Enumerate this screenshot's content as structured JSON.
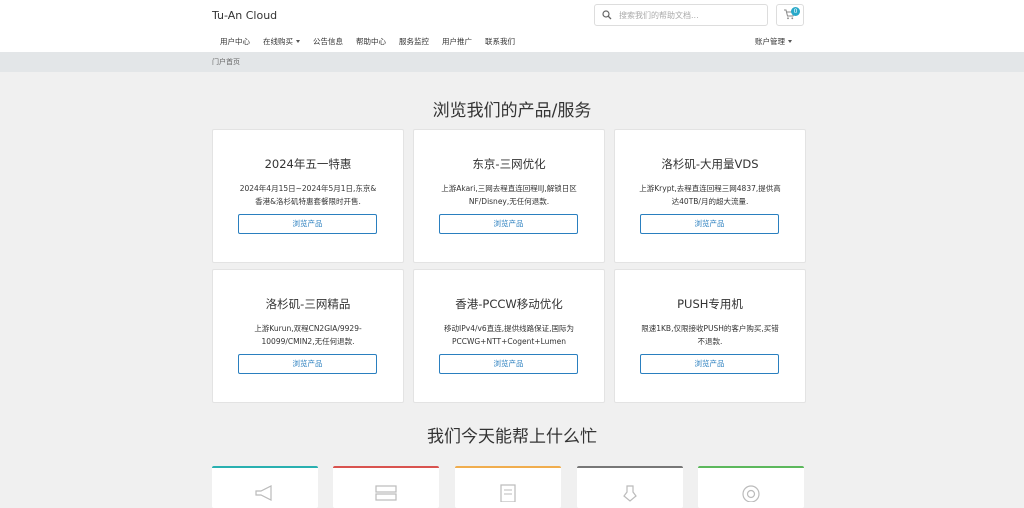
{
  "header": {
    "brand": "Tu-An Cloud",
    "search_placeholder": "搜索我们的帮助文档...",
    "cart_count": "0"
  },
  "nav": {
    "items": [
      {
        "label": "用户中心",
        "dropdown": false
      },
      {
        "label": "在线购买",
        "dropdown": true
      },
      {
        "label": "公告信息",
        "dropdown": false
      },
      {
        "label": "帮助中心",
        "dropdown": false
      },
      {
        "label": "服务监控",
        "dropdown": false
      },
      {
        "label": "用户推广",
        "dropdown": false
      },
      {
        "label": "联系我们",
        "dropdown": false
      }
    ],
    "account": "账户管理"
  },
  "breadcrumb": "门户首页",
  "products": {
    "title": "浏览我们的产品/服务",
    "button_label": "浏览产品",
    "cards": [
      {
        "title": "2024年五一特惠",
        "desc": "2024年4月15日~2024年5月1日,东京&香港&洛杉矶特惠套餐限时开售."
      },
      {
        "title": "东京-三网优化",
        "desc": "上游Akari,三网去程直连回程IIJ,解锁日区NF/Disney,无任何退款."
      },
      {
        "title": "洛杉矶-大用量VDS",
        "desc": "上游Krypt,去程直连回程三网4837,提供高达40TB/月的超大流量."
      },
      {
        "title": "洛杉矶-三网精品",
        "desc": "上游Kurun,双程CN2GIA/9929-10099/CMIN2,无任何退款."
      },
      {
        "title": "香港-PCCW移动优化",
        "desc": "移动IPv4/v6直连,提供线路保证,国际为PCCWG+NTT+Cogent+Lumen"
      },
      {
        "title": "PUSH专用机",
        "desc": "限速1KB,仅限接收PUSH的客户购买,买错不退款."
      }
    ]
  },
  "help": {
    "title": "我们今天能帮上什么忙",
    "cards": [
      {
        "icon": "megaphone-icon",
        "color": "#2ab0b0"
      },
      {
        "icon": "server-icon",
        "color": "#d9534f"
      },
      {
        "icon": "document-icon",
        "color": "#f0ad4e"
      },
      {
        "icon": "user-tie-icon",
        "color": "#777777"
      },
      {
        "icon": "lifebuoy-icon",
        "color": "#5cb85c"
      }
    ]
  },
  "colors": {
    "accent": "#2a7fbf",
    "badge": "#28a9c9"
  }
}
